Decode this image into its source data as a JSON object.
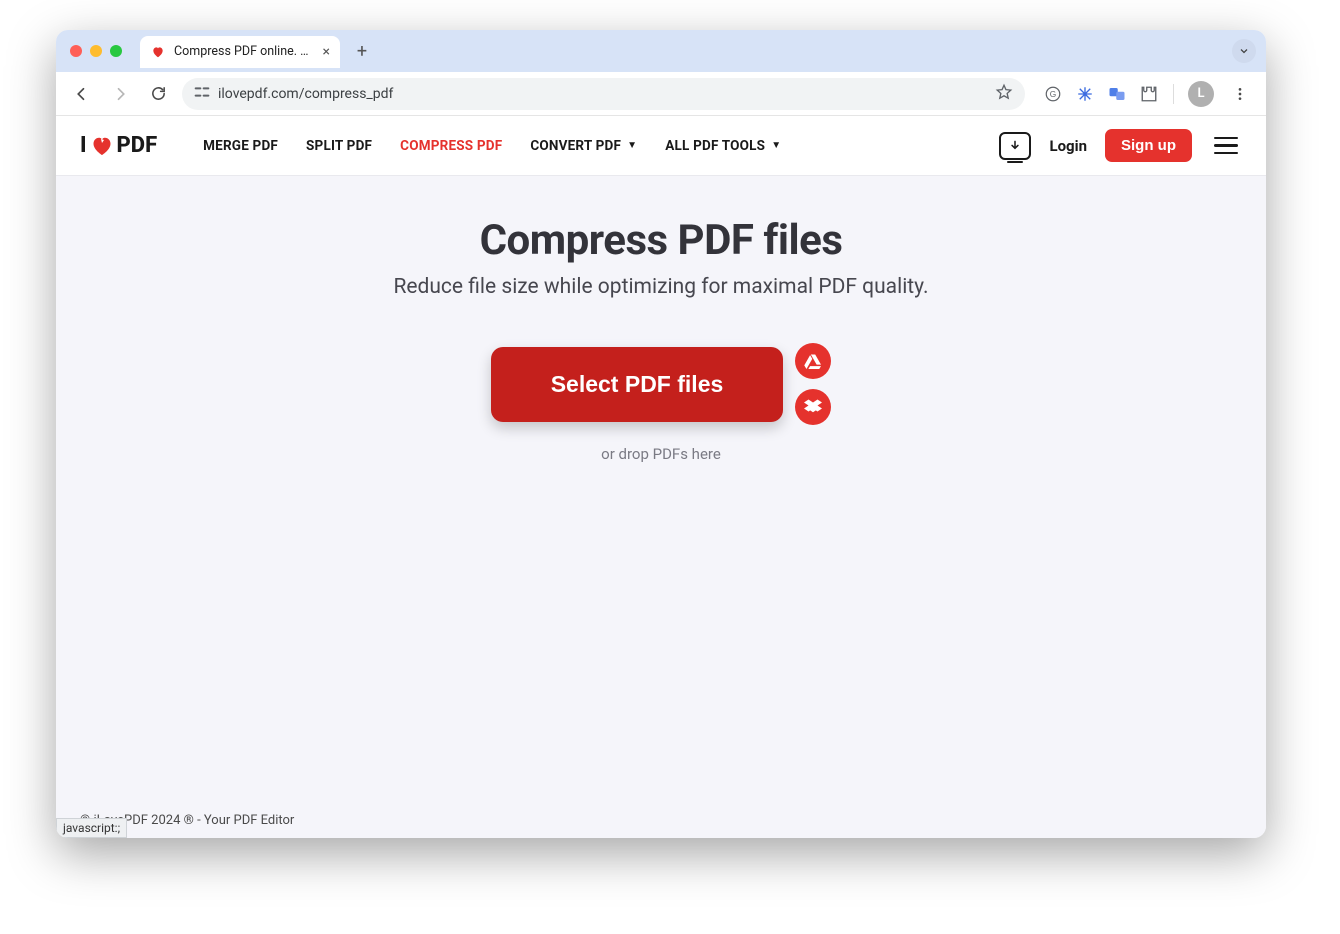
{
  "browser": {
    "tab": {
      "title": "Compress PDF online. Same",
      "favicon_name": "heart-icon"
    },
    "url": "ilovepdf.com/compress_pdf",
    "avatar_initial": "L"
  },
  "header": {
    "logo_prefix": "I",
    "logo_suffix": "PDF",
    "nav": {
      "merge": "MERGE PDF",
      "split": "SPLIT PDF",
      "compress": "COMPRESS PDF",
      "convert": "CONVERT PDF",
      "all": "ALL PDF TOOLS"
    },
    "login": "Login",
    "signup": "Sign up"
  },
  "main": {
    "title": "Compress PDF files",
    "subtitle": "Reduce file size while optimizing for maximal PDF quality.",
    "select_button": "Select PDF files",
    "drop_hint": "or drop PDFs here"
  },
  "footer": {
    "copyright": "© iLovePDF 2024 ® - Your PDF Editor",
    "status_hint": "javascript:;"
  },
  "colors": {
    "brand": "#e5322d"
  }
}
